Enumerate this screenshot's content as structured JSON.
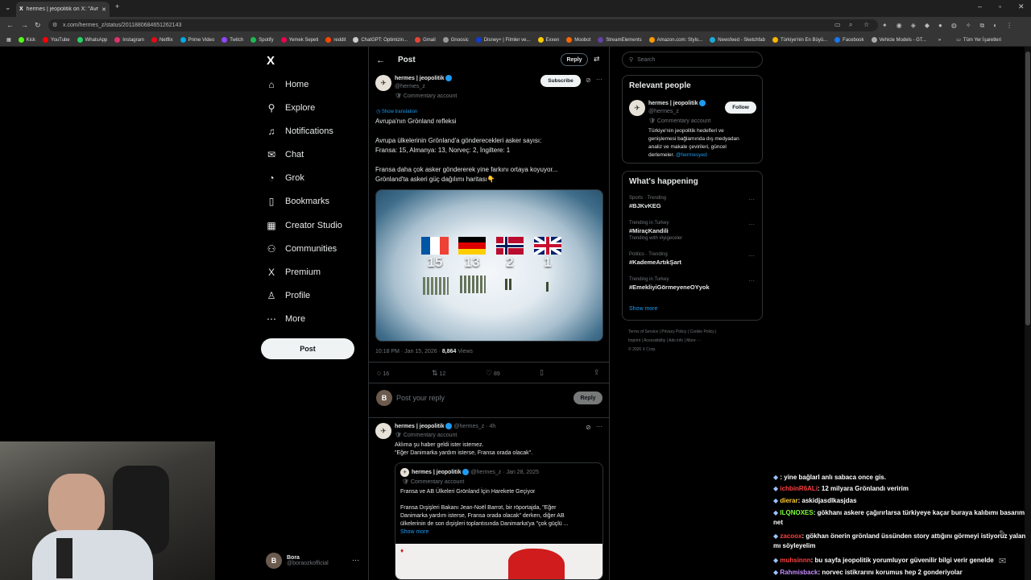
{
  "browser": {
    "tab_title": "hermes | jeopolitik on X: \"Avrupa...",
    "url": "x.com/hermes_z/status/2011880684651262143",
    "bookmarks": [
      {
        "label": "Kick",
        "color": "#53fc18"
      },
      {
        "label": "YouTube",
        "color": "#ff0000"
      },
      {
        "label": "WhatsApp",
        "color": "#25d366"
      },
      {
        "label": "Instagram",
        "color": "#e1306c"
      },
      {
        "label": "Netflix",
        "color": "#e50914"
      },
      {
        "label": "Prime Video",
        "color": "#00a8e1"
      },
      {
        "label": "Twitch",
        "color": "#9146ff"
      },
      {
        "label": "Spotify",
        "color": "#1db954"
      },
      {
        "label": "Yemek Sepeti",
        "color": "#ea004b"
      },
      {
        "label": "reddit",
        "color": "#ff4500"
      },
      {
        "label": "ChatGPT: Optimizin...",
        "color": "#cccccc"
      },
      {
        "label": "Gmail",
        "color": "#ea4335"
      },
      {
        "label": "Gnoosic",
        "color": "#999999"
      },
      {
        "label": "Disney+ | Filmler ve...",
        "color": "#113ccf"
      },
      {
        "label": "Exxen",
        "color": "#ffcc00"
      },
      {
        "label": "Moobot",
        "color": "#ff6600"
      },
      {
        "label": "StreamElements",
        "color": "#6441a5"
      },
      {
        "label": "Amazon.com: Stylo...",
        "color": "#ff9900"
      },
      {
        "label": "Newsfeed - Sketchfab",
        "color": "#1caad9"
      },
      {
        "label": "Türkiye'nin En Büyü...",
        "color": "#f7b500"
      },
      {
        "label": "Facebook",
        "color": "#1877f2"
      },
      {
        "label": "Vehicle Models - GT...",
        "color": "#aaaaaa"
      }
    ],
    "all_bookmarks": "Tüm Yer İşaretleri"
  },
  "nav": {
    "logo": "X",
    "items": [
      {
        "label": "Home",
        "icon": "home-icon",
        "glyph": "⌂"
      },
      {
        "label": "Explore",
        "icon": "search-icon",
        "glyph": "⚲"
      },
      {
        "label": "Notifications",
        "icon": "bell-icon",
        "glyph": "♫"
      },
      {
        "label": "Chat",
        "icon": "mail-icon",
        "glyph": "✉"
      },
      {
        "label": "Grok",
        "icon": "grok-icon",
        "glyph": "◔"
      },
      {
        "label": "Bookmarks",
        "icon": "bookmark-icon",
        "glyph": "▯"
      },
      {
        "label": "Creator Studio",
        "icon": "creator-icon",
        "glyph": "▦"
      },
      {
        "label": "Communities",
        "icon": "communities-icon",
        "glyph": "⚇"
      },
      {
        "label": "Premium",
        "icon": "premium-icon",
        "glyph": "X"
      },
      {
        "label": "Profile",
        "icon": "profile-icon",
        "glyph": "♙"
      },
      {
        "label": "More",
        "icon": "more-icon",
        "glyph": "⋯"
      }
    ],
    "post_button": "Post",
    "account_name": "Bora",
    "account_handle": "@boraozkofficial"
  },
  "post": {
    "header": "Post",
    "reply_button": "Reply",
    "author_name": "hermes | jeopolitik",
    "author_handle": "@hermes_z",
    "account_label": "Commentary account",
    "subscribe": "Subscribe",
    "show_translation": "Show translation",
    "line1": "Avrupa'nın Grönland refleksi",
    "line2": "Avrupa ülkelerinin Grönland'a gönderecekleri asker sayısı:",
    "line3": "Fransa: 15, Almanya: 13, Norveç: 2, İngiltere: 1",
    "line4": "Fransa daha çok asker göndererek yine farkını ortaya koyuyor...",
    "line5": "Grönland'ta askeri güç dağılımı haritası👇",
    "image": {
      "counts": [
        "15",
        "13",
        "2",
        "1"
      ]
    },
    "time": "10:18 PM · Jan 15, 2026 ·",
    "views": "8,864",
    "views_label": "Views",
    "replies": "16",
    "reposts": "12",
    "likes": "89",
    "reply_placeholder": "Post your reply",
    "reply_submit": "Reply"
  },
  "reply": {
    "author_name": "hermes | jeopolitik",
    "author_handle": "@hermes_z · 4h",
    "account_label": "Commentary account",
    "text1": "Aklıma şu haber geldi ister istemez.",
    "text2": "\"Eğer Danimarka yardım isterse, Fransa orada olacak\".",
    "quote_name": "hermes | jeopolitik",
    "quote_handle": "@hermes_z · Jan 28, 2025",
    "quote_account": "Commentary account",
    "quote_title": "Fransa ve AB Ülkeleri Grönland İçin Harekete Geçiyor",
    "quote_body1": "Fransa Dışişleri Bakanı Jean-Noël Barrot, bir röportajda, \"Eğer",
    "quote_body2": "Danimarka yardım isterse, Fransa orada olacak\" derken, diğer AB",
    "quote_body3": "ülkelerinin de son dışişleri toplantısında Danimarka'ya \"çok güçlü ...",
    "show_more": "Show more"
  },
  "right": {
    "search_placeholder": "Search",
    "relevant_title": "Relevant people",
    "rp_name": "hermes | jeopolitik",
    "rp_handle": "@hermes_z",
    "rp_account": "Commentary account",
    "rp_follow": "Follow",
    "rp_bio1": "Türkiye'nin jeopolitik hedefleri ve",
    "rp_bio2": "genişlemesi bağlamında dış medyadan",
    "rp_bio3": "analiz ve makale çevirileri, güncel",
    "rp_bio4": "derlemeler.",
    "rp_bio_link": "@hermesyed",
    "happening_title": "What's happening",
    "trends": [
      {
        "context": "Sports · Trending",
        "tag": "#BJKvKEG",
        "extra": ""
      },
      {
        "context": "Trending in Turkey",
        "tag": "#MiraçKandili",
        "extra": "Trending with #iyigeceler"
      },
      {
        "context": "Politics · Trending",
        "tag": "#KademeArtıkŞart",
        "extra": ""
      },
      {
        "context": "Trending in Turkey",
        "tag": "#EmekliyiGörmeyeneOYyok",
        "extra": ""
      }
    ],
    "show_more": "Show more",
    "footer1": "Terms of Service  |  Privacy Policy  |  Cookie Policy  |",
    "footer2": "Imprint  |  Accessibility  |  Ads info  |  More ···",
    "footer3": "© 2026 X Corp."
  },
  "chat": [
    {
      "user": "",
      "msg": ": yine bağlarl anlı sabaca once gis.",
      "color": "#ffffff"
    },
    {
      "user": "ichbinR6ALi",
      "msg": ": 12 milyara Grönlandı veririm",
      "color": "#ff4040"
    },
    {
      "user": "dierar",
      "msg": ": askidjasdlkasjdas",
      "color": "#ffcc33"
    },
    {
      "user": "ILQNOXES",
      "msg": ": gökhanı askere çağırırlarsa türkiyeye kaçar buraya kalıbımı basarım net",
      "color": "#7cff3c"
    },
    {
      "user": "zacoox",
      "msg": ": gökhan önerin grönland üssünden story attığını görmeyi istiyoruz yalan mı söyleyelim",
      "color": "#ff4040"
    },
    {
      "user": "muhsinnn",
      "msg": ": bu sayfa jeopolitik yorumluyor güvenilir bilgi verir genelde",
      "color": "#ff4040"
    },
    {
      "user": "Rahmisback",
      "msg": ": norvec istikrarını korumus hep 2 gonderiyolar",
      "color": "#c58cff"
    }
  ],
  "colors": {
    "accent": "#1d9bf0",
    "background": "#000000",
    "border": "#2f3336"
  }
}
